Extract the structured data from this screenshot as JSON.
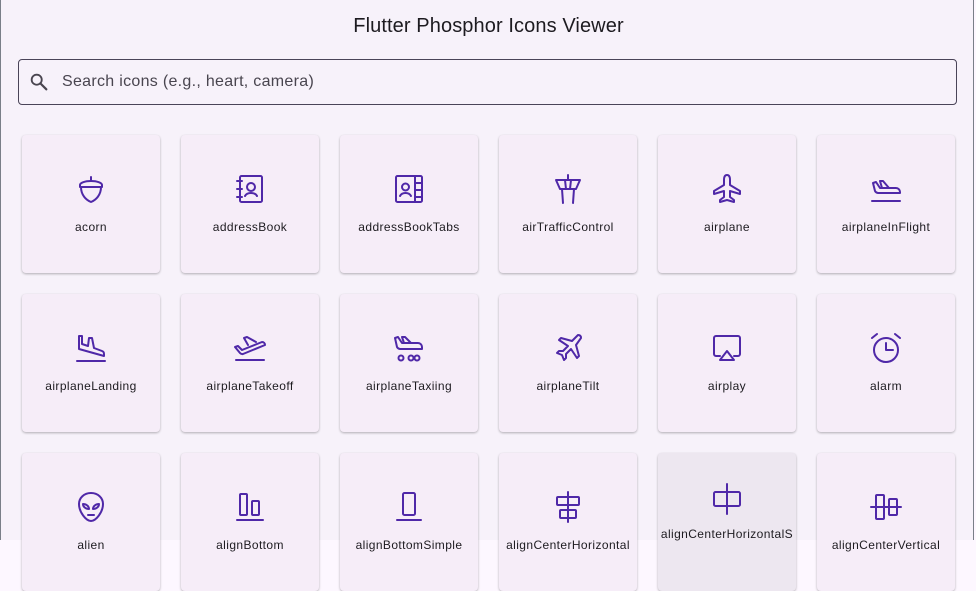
{
  "app": {
    "title": "Flutter Phosphor Icons Viewer"
  },
  "search": {
    "placeholder": "Search icons (e.g., heart, camera)",
    "value": "",
    "icon": "search-icon"
  },
  "colors": {
    "accent": "#4f28a8",
    "tile_bg": "#f6edf8",
    "page_bg": "#f7f2fa"
  },
  "icons": [
    {
      "label": "acorn",
      "icon": "acorn-icon"
    },
    {
      "label": "addressBook",
      "icon": "address-book-icon"
    },
    {
      "label": "addressBookTabs",
      "icon": "address-book-tabs-icon"
    },
    {
      "label": "airTrafficControl",
      "icon": "air-traffic-control-icon"
    },
    {
      "label": "airplane",
      "icon": "airplane-icon"
    },
    {
      "label": "airplaneInFlight",
      "icon": "airplane-in-flight-icon"
    },
    {
      "label": "airplaneLanding",
      "icon": "airplane-landing-icon"
    },
    {
      "label": "airplaneTakeoff",
      "icon": "airplane-takeoff-icon"
    },
    {
      "label": "airplaneTaxiing",
      "icon": "airplane-taxiing-icon"
    },
    {
      "label": "airplaneTilt",
      "icon": "airplane-tilt-icon"
    },
    {
      "label": "airplay",
      "icon": "airplay-icon"
    },
    {
      "label": "alarm",
      "icon": "alarm-icon"
    },
    {
      "label": "alien",
      "icon": "alien-icon"
    },
    {
      "label": "alignBottom",
      "icon": "align-bottom-icon"
    },
    {
      "label": "alignBottomSimple",
      "icon": "align-bottom-simple-icon"
    },
    {
      "label": "alignCenterHorizontal",
      "icon": "align-center-horizontal-icon"
    },
    {
      "label": "alignCenterHorizontalS",
      "icon": "align-center-horizontal-simple-icon"
    },
    {
      "label": "alignCenterVertical",
      "icon": "align-center-vertical-icon"
    }
  ]
}
